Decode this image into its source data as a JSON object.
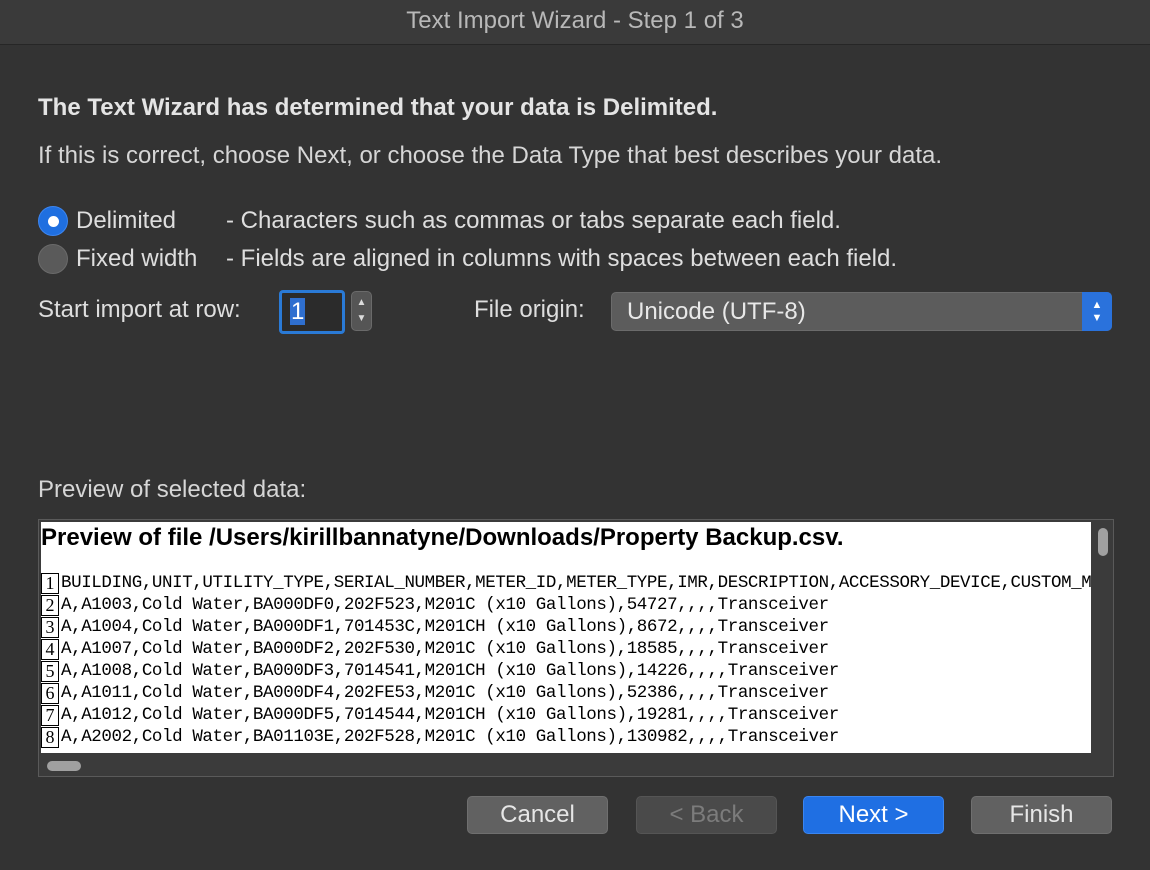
{
  "window": {
    "title": "Text Import Wizard - Step 1 of 3"
  },
  "wizard": {
    "heading": "The Text Wizard has determined that your data is Delimited.",
    "instruction": "If this is correct, choose Next, or choose the Data Type that best describes your data."
  },
  "data_type": {
    "selected": "Delimited",
    "options": [
      {
        "label": "Delimited",
        "description": "- Characters such as commas or tabs separate each field."
      },
      {
        "label": "Fixed width",
        "description": "- Fields are aligned in columns with spaces between each field."
      }
    ]
  },
  "start_row": {
    "label": "Start import at row:",
    "value": "1"
  },
  "file_origin": {
    "label": "File origin:",
    "value": "Unicode (UTF-8)"
  },
  "preview": {
    "label": "Preview of selected data:",
    "title": "Preview of file /Users/kirillbannatyne/Downloads/Property Backup.csv.",
    "lines": [
      {
        "num": "1",
        "text": "BUILDING,UNIT,UTILITY_TYPE,SERIAL_NUMBER,METER_ID,METER_TYPE,IMR,DESCRIPTION,ACCESSORY_DEVICE,CUSTOM_ME"
      },
      {
        "num": "2",
        "text": "A,A1003,Cold Water,BA000DF0,202F523,M201C (x10 Gallons),54727,,,,Transceiver"
      },
      {
        "num": "3",
        "text": "A,A1004,Cold Water,BA000DF1,701453C,M201CH (x10 Gallons),8672,,,,Transceiver"
      },
      {
        "num": "4",
        "text": "A,A1007,Cold Water,BA000DF2,202F530,M201C (x10 Gallons),18585,,,,Transceiver"
      },
      {
        "num": "5",
        "text": "A,A1008,Cold Water,BA000DF3,7014541,M201CH (x10 Gallons),14226,,,,Transceiver"
      },
      {
        "num": "6",
        "text": "A,A1011,Cold Water,BA000DF4,202FE53,M201C (x10 Gallons),52386,,,,Transceiver"
      },
      {
        "num": "7",
        "text": "A,A1012,Cold Water,BA000DF5,7014544,M201CH (x10 Gallons),19281,,,,Transceiver"
      },
      {
        "num": "8",
        "text": "A,A2002,Cold Water,BA01103E,202F528,M201C (x10 Gallons),130982,,,,Transceiver"
      }
    ]
  },
  "buttons": {
    "cancel": "Cancel",
    "back": "< Back",
    "next": "Next >",
    "finish": "Finish"
  },
  "colors": {
    "accent": "#1f6fe3",
    "background": "#333333",
    "preview_background": "#ffffff"
  }
}
